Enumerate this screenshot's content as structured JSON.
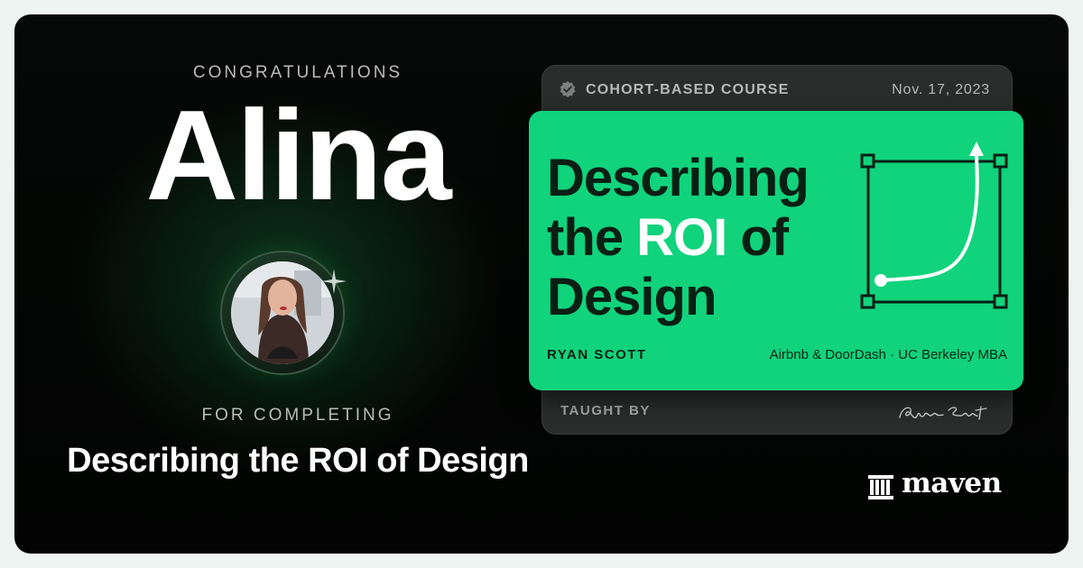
{
  "certificate": {
    "congrats_label": "CONGRATULATIONS",
    "recipient_name": "Alina",
    "completing_label": "FOR COMPLETING",
    "course_title": "Describing the ROI of Design"
  },
  "card": {
    "badge_label": "COHORT-BASED COURSE",
    "date": "Nov. 17, 2023",
    "title_part1": "Describing the ",
    "title_highlight": "ROI",
    "title_part2": " of Design",
    "instructor_name": "RYAN SCOTT",
    "instructor_credentials": "Airbnb & DoorDash · UC Berkeley MBA",
    "taught_by_label": "TAUGHT BY",
    "signature": "Ryan Scott"
  },
  "brand": {
    "name": "maven",
    "accent_color": "#10d37c"
  },
  "icons": {
    "badge": "verified-badge-icon",
    "sparkle": "sparkle-icon",
    "brand": "maven-columns-icon",
    "graph": "roi-growth-graph-icon"
  }
}
